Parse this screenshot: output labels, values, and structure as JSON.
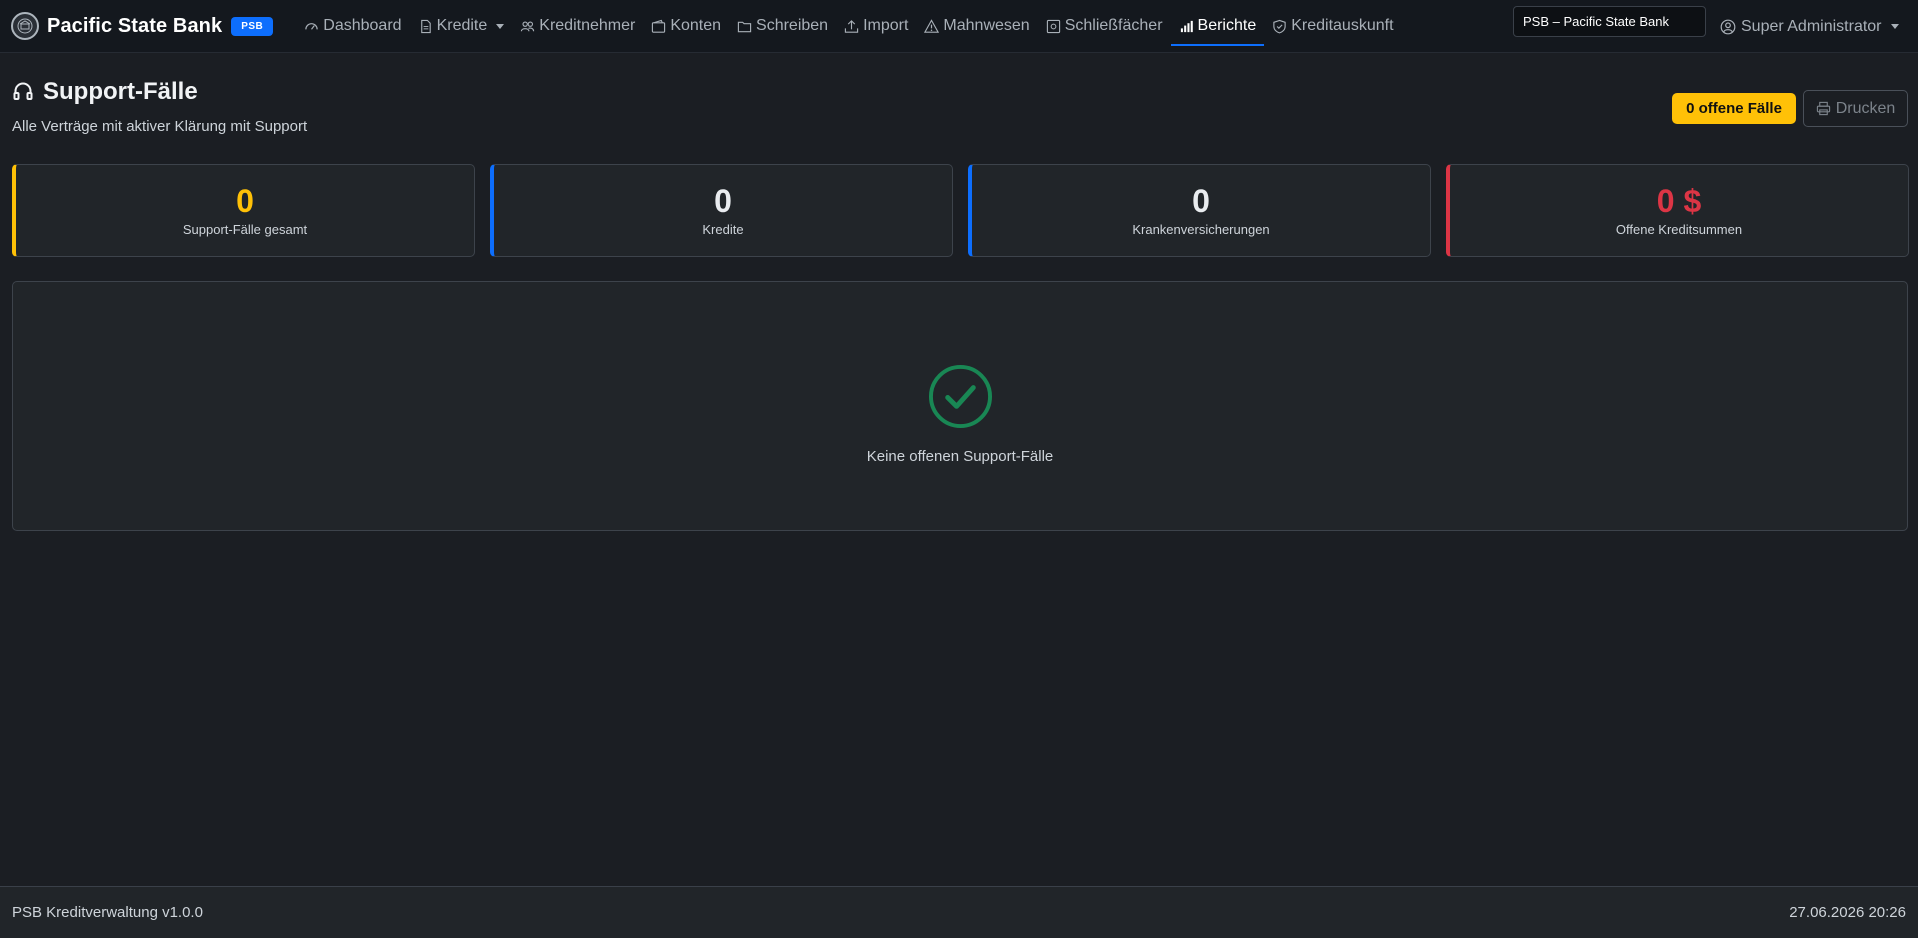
{
  "brand": {
    "title": "Pacific State Bank",
    "badge": "PSB"
  },
  "nav": {
    "items": [
      {
        "label": "Dashboard",
        "icon": "speedometer-icon"
      },
      {
        "label": "Kredite",
        "icon": "document-icon"
      },
      {
        "label": "Kreditnehmer",
        "icon": "people-icon"
      },
      {
        "label": "Konten",
        "icon": "wallet-icon"
      },
      {
        "label": "Schreiben",
        "icon": "folder-icon"
      },
      {
        "label": "Import",
        "icon": "upload-icon"
      },
      {
        "label": "Mahnwesen",
        "icon": "warning-icon"
      },
      {
        "label": "Schließfächer",
        "icon": "safe-icon"
      },
      {
        "label": "Berichte",
        "icon": "bar-chart-icon",
        "active": true
      },
      {
        "label": "Kreditauskunft",
        "icon": "shield-check-icon"
      }
    ],
    "tenant": "PSB – Pacific State Bank",
    "user": "Super Administrator"
  },
  "page": {
    "title": "Support-Fälle",
    "subtitle": "Alle Verträge mit aktiver Klärung mit Support",
    "open_badge": "0 offene Fälle",
    "print_label": "Drucken"
  },
  "stats": [
    {
      "value": "0",
      "label": "Support-Fälle gesamt",
      "color": "#ffc107",
      "accent": "#ffc107"
    },
    {
      "value": "0",
      "label": "Kredite",
      "color": "#e9ecef",
      "accent": "#0d6efd"
    },
    {
      "value": "0",
      "label": "Krankenversicherungen",
      "color": "#e9ecef",
      "accent": "#0d6efd"
    },
    {
      "value": "0 $",
      "label": "Offene Kreditsummen",
      "color": "#dc3545",
      "accent": "#dc3545"
    }
  ],
  "empty": {
    "text": "Keine offenen Support-Fälle",
    "icon": "check-circle-icon",
    "color": "#198754"
  },
  "footer": {
    "app": "PSB Kreditverwaltung v1.0.0",
    "datetime": "27.06.2026 20:26"
  }
}
